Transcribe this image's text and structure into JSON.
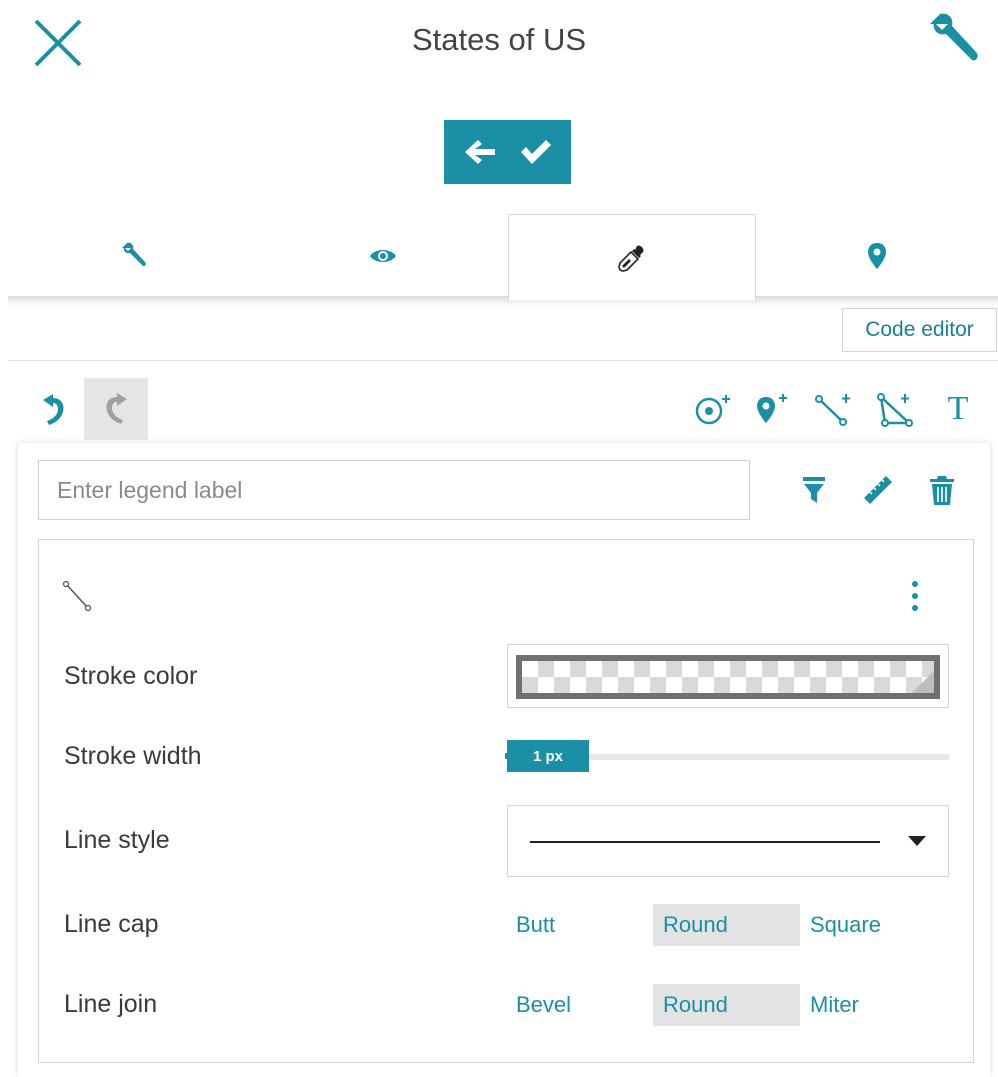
{
  "header": {
    "title": "States of US"
  },
  "tabs": [
    {
      "id": "settings",
      "icon": "wrench-icon",
      "active": false
    },
    {
      "id": "view",
      "icon": "eye-icon",
      "active": false
    },
    {
      "id": "style",
      "icon": "eyedropper-icon",
      "active": true
    },
    {
      "id": "location",
      "icon": "map-marker-icon",
      "active": false
    }
  ],
  "code_editor": {
    "label": "Code editor"
  },
  "toolbar": {
    "undo_icon": "undo-icon",
    "redo_icon": "redo-icon",
    "tools": [
      "add-circle-icon",
      "add-marker-icon",
      "add-line-icon",
      "add-polygon-icon",
      "add-text-icon"
    ],
    "text_tool_glyph": "T"
  },
  "legend": {
    "placeholder": "Enter legend label",
    "value": ""
  },
  "style": {
    "stroke_color_label": "Stroke color",
    "stroke_width_label": "Stroke width",
    "stroke_width_value": "1 px",
    "line_style_label": "Line style",
    "line_cap_label": "Line cap",
    "line_cap_options": [
      "Butt",
      "Round",
      "Square"
    ],
    "line_cap_selected": "Round",
    "line_join_label": "Line join",
    "line_join_options": [
      "Bevel",
      "Round",
      "Miter"
    ],
    "line_join_selected": "Round"
  },
  "colors": {
    "accent": "#1a8fa5",
    "selected_bg": "#e3e3e3"
  }
}
